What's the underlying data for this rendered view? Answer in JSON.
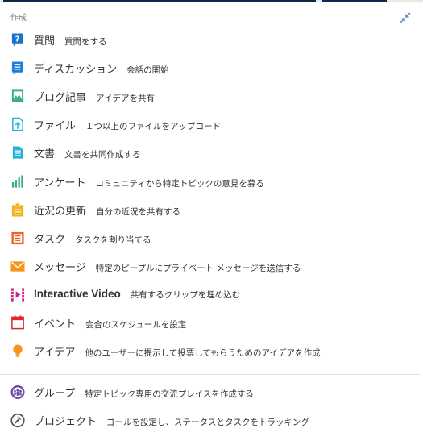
{
  "header": {
    "title": "作成"
  },
  "colors": {
    "accent": "#1a73c8",
    "topbar": "#0d2a4e"
  },
  "items": [
    {
      "title": "質問",
      "desc": "質問をする",
      "icon": "question-bubble-icon",
      "color": "#1a73c8"
    },
    {
      "title": "ディスカッション",
      "desc": "会話の開始",
      "icon": "discussion-bubble-icon",
      "color": "#1e7fd8"
    },
    {
      "title": "ブログ記事",
      "desc": "アイデアを共有",
      "icon": "blog-image-icon",
      "color": "#3aae7b"
    },
    {
      "title": "ファイル",
      "desc": "１つ以上のファイルをアップロード",
      "icon": "file-upload-icon",
      "color": "#22b3d6"
    },
    {
      "title": "文書",
      "desc": "文書を共同作成する",
      "icon": "document-icon",
      "color": "#22b3d6"
    },
    {
      "title": "アンケート",
      "desc": "コミュニティから特定トピックの意見を募る",
      "icon": "poll-bars-icon",
      "color": "#3aae7b"
    },
    {
      "title": "近況の更新",
      "desc": "自分の近況を共有する",
      "icon": "status-clipboard-icon",
      "color": "#f5b21f"
    },
    {
      "title": "タスク",
      "desc": "タスクを割り当てる",
      "icon": "task-list-icon",
      "color": "#f0622b"
    },
    {
      "title": "メッセージ",
      "desc": "特定のピープルにプライベート メッセージを送信する",
      "icon": "envelope-icon",
      "color": "#f7941d"
    },
    {
      "title": "Interactive Video",
      "desc": "共有するクリップを埋め込む",
      "icon": "video-film-icon",
      "color": "#c7258e"
    },
    {
      "title": "イベント",
      "desc": "会合のスケジュールを設定",
      "icon": "calendar-icon",
      "color": "#e0262b"
    },
    {
      "title": "アイデア",
      "desc": "他のユーザーに提示して投票してもらうためのアイデアを作成",
      "icon": "lightbulb-icon",
      "color": "#f7941d"
    }
  ],
  "places": [
    {
      "title": "グループ",
      "desc": "特定トピック専用の交流プレイスを作成する",
      "icon": "group-people-icon",
      "color": "#6a4aa5"
    },
    {
      "title": "プロジェクト",
      "desc": "ゴールを設定し、ステータスとタスクをトラッキング",
      "icon": "project-gauge-icon",
      "color": "#555555"
    }
  ]
}
